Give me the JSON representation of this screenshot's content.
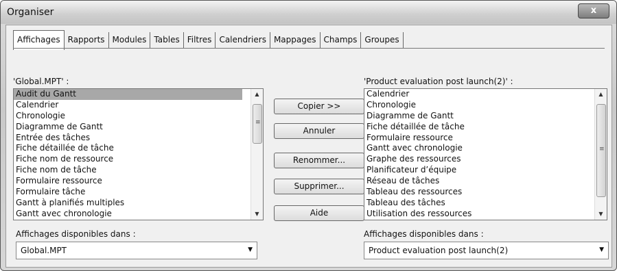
{
  "window": {
    "title": "Organiser",
    "close_label": "x"
  },
  "tabs": [
    "Affichages",
    "Rapports",
    "Modules",
    "Tables",
    "Filtres",
    "Calendriers",
    "Mappages",
    "Champs",
    "Groupes"
  ],
  "left": {
    "label": "'Global.MPT' :",
    "items": [
      "Audit du Gantt",
      "Calendrier",
      "Chronologie",
      "Diagramme de Gantt",
      "Entrée des tâches",
      "Fiche détaillée de tâche",
      "Fiche nom de ressource",
      "Fiche nom de tâche",
      "Formulaire ressource",
      "Formulaire tâche",
      "Gantt à planifiés multiples",
      "Gantt avec chronologie"
    ],
    "selected_index": 0,
    "avail_label": "Affichages disponibles dans :",
    "combo_value": "Global.MPT"
  },
  "right": {
    "label": "'Product evaluation post launch(2)' :",
    "items": [
      "Calendrier",
      "Chronologie",
      "Diagramme de Gantt",
      "Fiche détaillée de tâche",
      "Formulaire ressource",
      "Gantt avec chronologie",
      "Graphe des ressources",
      "Planificateur d’équipe",
      "Réseau de tâches",
      "Tableau des ressources",
      "Tableau des tâches",
      "Utilisation des ressources"
    ],
    "avail_label": "Affichages disponibles dans :",
    "combo_value": "Product evaluation post launch(2)"
  },
  "buttons": {
    "copy": "Copier >>",
    "cancel": "Annuler",
    "rename": "Renommer...",
    "delete": "Supprimer...",
    "help": "Aide"
  },
  "icons": {
    "scroll_up": "triangle-up-icon",
    "scroll_down": "triangle-down-icon",
    "dropdown": "triangle-down-icon",
    "close": "close-icon"
  }
}
